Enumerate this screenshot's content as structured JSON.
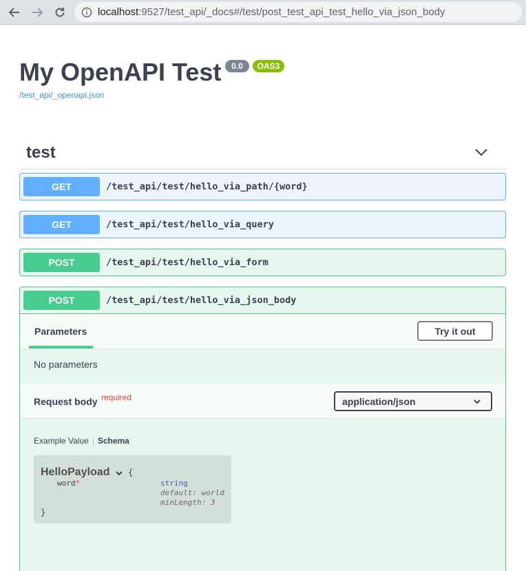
{
  "browser": {
    "url_host": "localhost",
    "url_rest": ":9527/test_api/_docs#/test/post_test_api_test_hello_via_json_body",
    "icons": [
      "back-arrow-icon",
      "forward-arrow-icon",
      "reload-icon",
      "info-icon"
    ]
  },
  "info": {
    "title": "My OpenAPI Test",
    "version": "0.0",
    "oas_badge": "OAS3",
    "spec_link": "/test_api/_openapi.json"
  },
  "tag": {
    "name": "test"
  },
  "operations": [
    {
      "method": "GET",
      "path": "/test_api/test/hello_via_path/{word}"
    },
    {
      "method": "GET",
      "path": "/test_api/test/hello_via_query"
    },
    {
      "method": "POST",
      "path": "/test_api/test/hello_via_form"
    },
    {
      "method": "POST",
      "path": "/test_api/test/hello_via_json_body"
    }
  ],
  "expanded_op": {
    "parameters_tab": "Parameters",
    "try_button": "Try it out",
    "no_params": "No parameters",
    "request_body_label": "Request body",
    "required_label": "required",
    "content_type": "application/json",
    "tab_example": "Example Value",
    "tab_schema": "Schema",
    "model": {
      "name": "HelloPayload",
      "open_brace": "{",
      "close_brace": "}",
      "prop_name": "word",
      "prop_required_mark": "*",
      "prop_type": "string",
      "prop_default": "default: world",
      "prop_minlength": "minLength: 3"
    }
  },
  "colors": {
    "get": "#61affe",
    "post": "#49cc90",
    "text": "#3b4151",
    "required": "#f93e3e"
  }
}
